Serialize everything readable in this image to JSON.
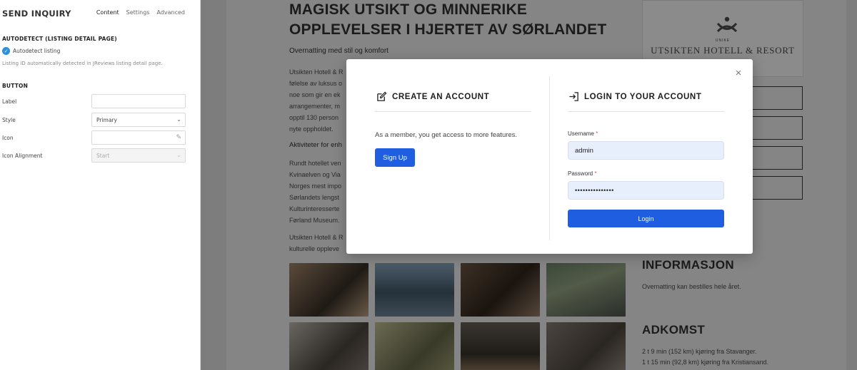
{
  "editor": {
    "title": "SEND INQUIRY",
    "tabs": [
      "Content",
      "Settings",
      "Advanced"
    ],
    "autodetect_section": "AUTODETECT (LISTING DETAIL PAGE)",
    "autodetect_checkbox": "Autodetect listing",
    "autodetect_hint": "Listing ID automatically detected in JReviews listing detail page.",
    "button_section": "BUTTON",
    "fields": {
      "label": {
        "label": "Label",
        "value": ""
      },
      "style": {
        "label": "Style",
        "value": "Primary"
      },
      "icon": {
        "label": "Icon",
        "value": ""
      },
      "icon_alignment": {
        "label": "Icon Alignment",
        "value": "Start"
      }
    }
  },
  "page": {
    "title": "MAGISK UTSIKT OG MINNERIKE OPPLEVELSER I HJERTET AV SØRLANDET",
    "subtitle": "Overnatting med stil og komfort",
    "para1": [
      "Utsikten Hotell & R",
      "følelse av luksus o",
      "noe som gir en ek",
      "arrangementer, m",
      "opptil 130 person",
      "nyte oppholdet."
    ],
    "activities_heading": "Aktiviteter for enh",
    "para2": [
      "Rundt hotellet ven",
      "Kvinaelven og Via",
      "Norges mest impo",
      "Sørlandets lengst",
      "Kulturinteresserte",
      "Førland Museum."
    ],
    "para3": [
      "Utsikten Hotell & R",
      "kulturelle oppleve"
    ],
    "logo": {
      "small": "UNIKE",
      "name": "UTSIKTEN HOTELL & RESORT"
    },
    "info_heading": "INFORMASJON",
    "info_text": "Overnatting kan bestilles hele året.",
    "adkomst_heading": "ADKOMST",
    "adkomst_lines": [
      "2 t 9 min (152 km) kjøring fra Stavanger.",
      "1 t 15 min (92,8 km) kjøring fra Kristiansand."
    ]
  },
  "modal": {
    "create": {
      "title": "CREATE AN ACCOUNT",
      "text": "As a member, you get access to more features.",
      "button": "Sign Up"
    },
    "login": {
      "title": "LOGIN TO YOUR ACCOUNT",
      "username_label": "Username",
      "username_value": "admin",
      "password_label": "Password",
      "password_value": "•••••••••••••••",
      "required_mark": "*",
      "button": "Login"
    },
    "close": "×"
  },
  "colors": {
    "primary_button": "#1f5ee0",
    "input_fill": "#e8effc",
    "overlay": "#7d7d7d",
    "check": "#2f8fd8"
  }
}
